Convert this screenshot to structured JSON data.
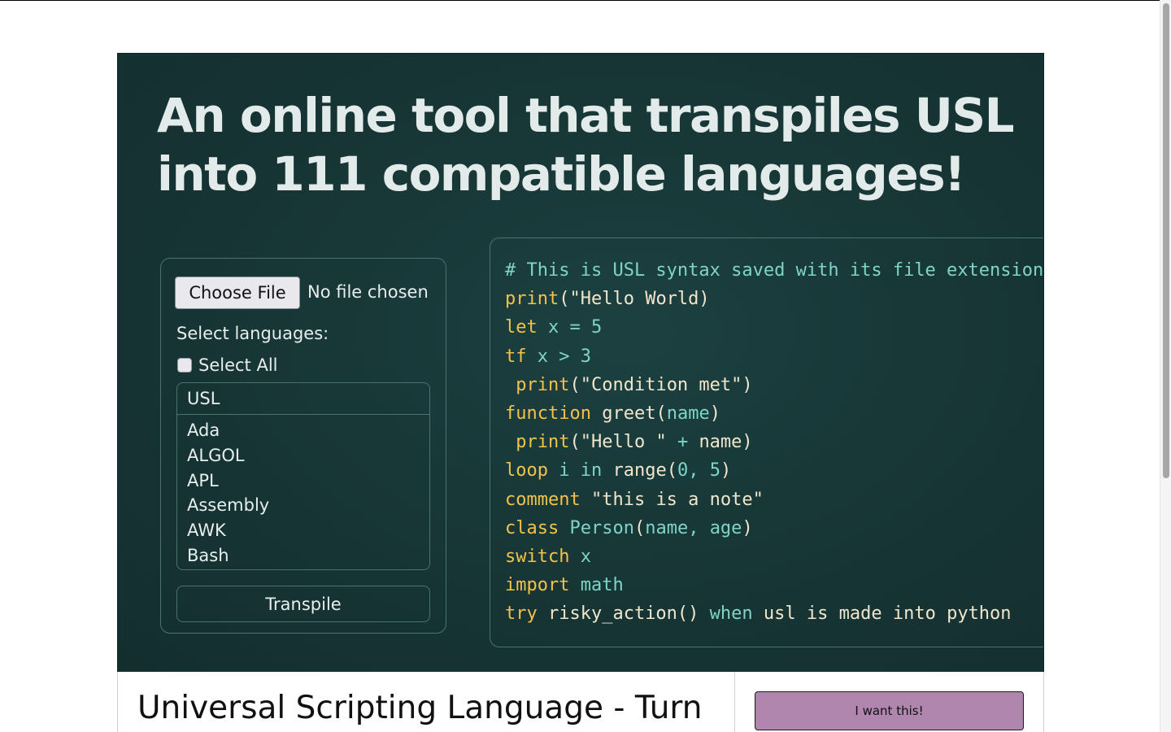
{
  "hero": {
    "title": "An online tool that transpiles USL into 111 compatible languages!"
  },
  "panel": {
    "file_button": "Choose File",
    "file_status": "No file chosen",
    "select_label": "Select languages:",
    "select_all_label": "Select All",
    "select_all_checked": false,
    "list_header": "USL",
    "languages": [
      "Ada",
      "ALGOL",
      "APL",
      "Assembly",
      "AWK",
      "Bash"
    ],
    "transpile_button": "Transpile"
  },
  "code": {
    "lines": [
      [
        [
          "c",
          "# This is USL syntax saved with its file extension .usl"
        ]
      ],
      [
        [
          "k",
          "print"
        ],
        [
          "s",
          "(\"Hello World)"
        ]
      ],
      [
        [
          "k",
          "let "
        ],
        [
          "c",
          "x = 5"
        ]
      ],
      [
        [
          "k",
          "tf "
        ],
        [
          "c",
          "x > 3"
        ]
      ],
      [
        [
          "k",
          " print"
        ],
        [
          "s",
          "(\"Condition met\")"
        ]
      ],
      [
        [
          "k",
          "function "
        ],
        [
          "s",
          "greet("
        ],
        [
          "c",
          "name"
        ],
        [
          "s",
          ")"
        ]
      ],
      [
        [
          "k",
          " print"
        ],
        [
          "s",
          "(\"Hello \" "
        ],
        [
          "c",
          "+ "
        ],
        [
          "s",
          "name)"
        ]
      ],
      [
        [
          "k",
          "loop "
        ],
        [
          "c",
          "i in "
        ],
        [
          "s",
          "range("
        ],
        [
          "c",
          "0, 5"
        ],
        [
          "s",
          ")"
        ]
      ],
      [
        [
          "k",
          "comment "
        ],
        [
          "s",
          "\"this is a note\""
        ]
      ],
      [
        [
          "k",
          "class "
        ],
        [
          "c",
          "Person"
        ],
        [
          "s",
          "("
        ],
        [
          "c",
          "name, age"
        ],
        [
          "s",
          ")"
        ]
      ],
      [
        [
          "k",
          "switch "
        ],
        [
          "c",
          "x"
        ]
      ],
      [
        [
          "k",
          "import "
        ],
        [
          "c",
          "math"
        ]
      ],
      [
        [
          "k",
          "try "
        ],
        [
          "s",
          "risky_action() "
        ],
        [
          "c",
          "when "
        ],
        [
          "s",
          "usl is made into python"
        ]
      ]
    ]
  },
  "product": {
    "title": "Universal Scripting Language - Turn",
    "buy_button": "I want this!"
  }
}
